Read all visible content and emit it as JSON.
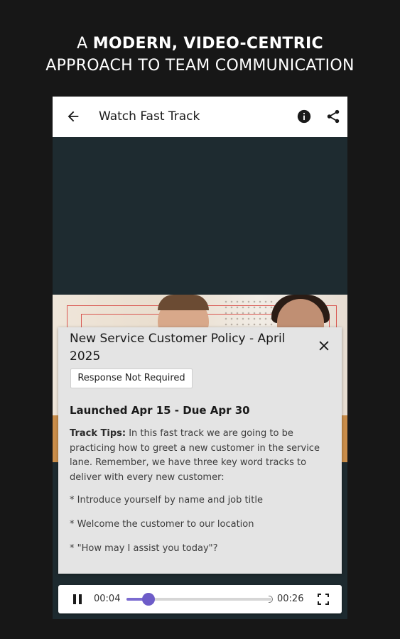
{
  "headline": {
    "line1_prefix": "A ",
    "line1_bold": "MODERN, VIDEO-CENTRIC",
    "line2": "APPROACH TO TEAM COMMUNICATION"
  },
  "appbar": {
    "title": "Watch Fast Track",
    "back_icon": "arrow-back-icon",
    "info_icon": "info-icon",
    "share_icon": "share-icon"
  },
  "card": {
    "title": "New Service Customer Policy - April 2025",
    "badge": "Response Not Required",
    "dates": "Launched Apr 15 - Due Apr 30",
    "tips_label": "Track Tips:",
    "tips_text": " In this fast track we are going to be practicing how to greet a new customer in the service lane. Remember, we have three key word tracks to deliver with every new customer:",
    "bullets": [
      "* Introduce yourself by name and job title",
      "* Welcome the customer to our location",
      "* \"How may I assist you today\"?"
    ]
  },
  "player": {
    "current_time": "00:04",
    "duration": "00:26",
    "progress": 0.154,
    "accent": "#6d5cc8"
  },
  "colors": {
    "background": "#171717",
    "video_dark": "#1e2b30",
    "card": "#e4e4e4"
  }
}
